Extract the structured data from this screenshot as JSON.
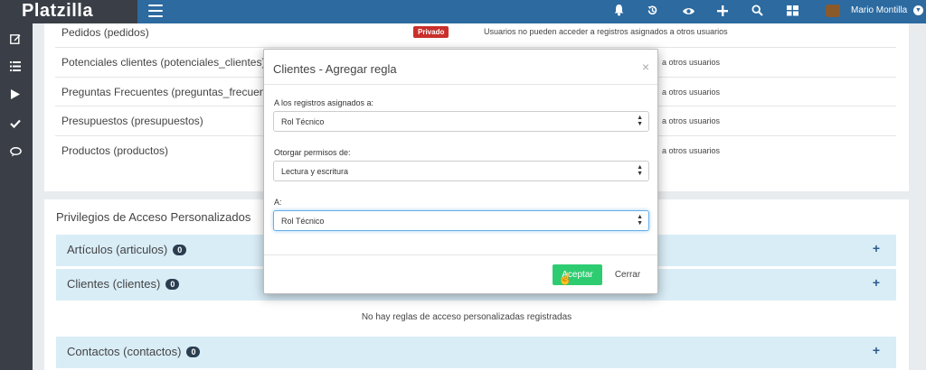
{
  "brand": {
    "name": "Platzilla"
  },
  "topbar": {
    "icons": [
      "bell-icon",
      "history-icon",
      "eye-icon",
      "plus-icon",
      "search-icon",
      "grid-icon"
    ],
    "user_name": "Mario Montilla"
  },
  "sidebar": {
    "icons": [
      "edit-icon",
      "list-icon",
      "play-icon",
      "check-icon",
      "chat-icon"
    ]
  },
  "permissions": {
    "rows": [
      {
        "name": "Pedidos (pedidos)",
        "badge": "Privado",
        "desc": "Usuarios no pueden acceder a registros asignados a otros usuarios"
      },
      {
        "name": "Potenciales clientes (potenciales_clientes)",
        "desc": "a otros usuarios"
      },
      {
        "name": "Preguntas Frecuentes (preguntas_frecuentes)",
        "desc": "a otros usuarios"
      },
      {
        "name": "Presupuestos (presupuestos)",
        "desc": "a otros usuarios"
      },
      {
        "name": "Productos (productos)",
        "desc": "a otros usuarios"
      }
    ]
  },
  "custom_access": {
    "title": "Privilegios de Acceso Personalizados",
    "modules": [
      {
        "label": "Artículos (articulos)",
        "count": "0"
      },
      {
        "label": "Clientes (clientes)",
        "count": "0"
      },
      {
        "label": "Contactos (contactos)",
        "count": "0"
      }
    ],
    "empty_message": "No hay reglas de acceso personalizadas registradas"
  },
  "modal": {
    "title": "Clientes - Agregar regla",
    "close_symbol": "×",
    "field1": {
      "label": "A los registros asignados a:",
      "value": "Rol Técnico"
    },
    "field2": {
      "label": "Otorgar permisos de:",
      "value": "Lectura y escritura"
    },
    "field3": {
      "label": "A:",
      "value": "Rol Técnico"
    },
    "accept_label": "Aceptar",
    "close_label": "Cerrar"
  }
}
